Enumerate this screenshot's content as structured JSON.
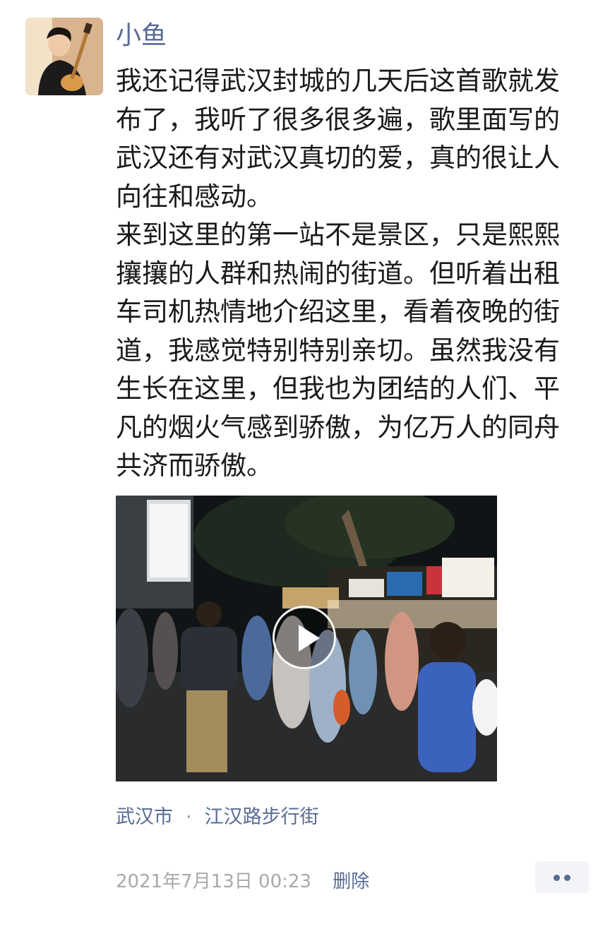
{
  "post": {
    "author": "小鱼",
    "paragraphs": [
      "我还记得武汉封城的几天后这首歌就发布了，我听了很多很多遍，歌里面写的武汉还有对武汉真切的爱，真的很让人向往和感动。",
      "来到这里的第一站不是景区，只是熙熙攘攘的人群和热闹的街道。但听着出租车司机热情地介绍这里，看着夜晚的街道，我感觉特别特别亲切。虽然我没有生长在这里，但我也为团结的人们、平凡的烟火气感到骄傲，为亿万人的同舟共济而骄傲。"
    ],
    "location": {
      "city": "武汉市",
      "separator": "·",
      "place": "江汉路步行街"
    },
    "timestamp": "2021年7月13日 00:23",
    "delete_label": "删除"
  },
  "icons": {
    "play": "play-icon",
    "more": "more-dots-icon"
  },
  "colors": {
    "link": "#576b95",
    "timestamp": "#a9a9a9",
    "text": "#1a1a1a"
  }
}
